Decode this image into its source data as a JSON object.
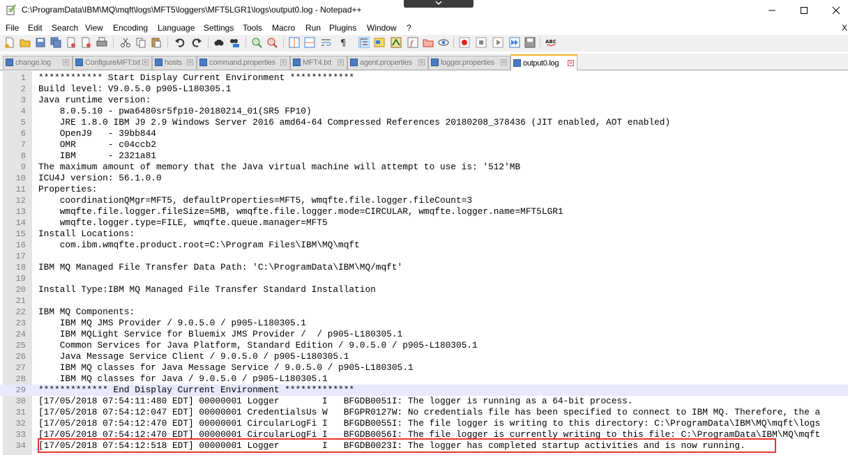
{
  "window": {
    "title": "C:\\ProgramData\\IBM\\MQ\\mqft\\logs\\MFT5\\loggers\\MFT5LGR1\\logs\\output0.log - Notepad++",
    "menu_close": "X"
  },
  "menu": [
    "File",
    "Edit",
    "Search",
    "View",
    "Encoding",
    "Language",
    "Settings",
    "Tools",
    "Macro",
    "Run",
    "Plugins",
    "Window",
    "?"
  ],
  "tabs": [
    {
      "label": "change.log"
    },
    {
      "label": "ConfigureMFT.txt"
    },
    {
      "label": "hosts"
    },
    {
      "label": "command.properties"
    },
    {
      "label": "MFT4.txt"
    },
    {
      "label": "agent.properties"
    },
    {
      "label": "logger.properties"
    },
    {
      "label": "output0.log",
      "active": true
    }
  ],
  "editor": {
    "current_line": 29,
    "highlighted_line": 34,
    "lines": [
      "************ Start Display Current Environment ************",
      "Build level: V9.0.5.0 p905-L180305.1",
      "Java runtime version:",
      "    8.0.5.10 - pwa6480sr5fp10-20180214_01(SR5 FP10)",
      "    JRE 1.8.0 IBM J9 2.9 Windows Server 2016 amd64-64 Compressed References 20180208_378436 (JIT enabled, AOT enabled)",
      "    OpenJ9   - 39bb844",
      "    OMR      - c04ccb2",
      "    IBM      - 2321a81",
      "The maximum amount of memory that the Java virtual machine will attempt to use is: '512'MB",
      "ICU4J version: 56.1.0.0",
      "Properties:",
      "    coordinationQMgr=MFT5, defaultProperties=MFT5, wmqfte.file.logger.fileCount=3",
      "    wmqfte.file.logger.fileSize=5MB, wmqfte.file.logger.mode=CIRCULAR, wmqfte.logger.name=MFT5LGR1",
      "    wmqfte.logger.type=FILE, wmqfte.queue.manager=MFT5",
      "Install Locations:",
      "    com.ibm.wmqfte.product.root=C:\\Program Files\\IBM\\MQ\\mqft",
      "",
      "IBM MQ Managed File Transfer Data Path: 'C:\\ProgramData\\IBM\\MQ/mqft'",
      "",
      "Install Type:IBM MQ Managed File Transfer Standard Installation",
      "",
      "IBM MQ Components:",
      "    IBM MQ JMS Provider / 9.0.5.0 / p905-L180305.1",
      "    IBM MQLight Service for Bluemix JMS Provider /  / p905-L180305.1",
      "    Common Services for Java Platform, Standard Edition / 9.0.5.0 / p905-L180305.1",
      "    Java Message Service Client / 9.0.5.0 / p905-L180305.1",
      "    IBM MQ classes for Java Message Service / 9.0.5.0 / p905-L180305.1",
      "    IBM MQ classes for Java / 9.0.5.0 / p905-L180305.1",
      "************* End Display Current Environment *************",
      "[17/05/2018 07:54:11:480 EDT] 00000001 Logger        I   BFGDB0051I: The logger is running as a 64-bit process.",
      "[17/05/2018 07:54:12:047 EDT] 00000001 CredentialsUs W   BFGPR0127W: No credentials file has been specified to connect to IBM MQ. Therefore, the a",
      "[17/05/2018 07:54:12:470 EDT] 00000001 CircularLogFi I   BFGDB0055I: The file logger is writing to this directory: C:\\ProgramData\\IBM\\MQ\\mqft\\logs",
      "[17/05/2018 07:54:12:470 EDT] 00000001 CircularLogFi I   BFGDB0056I: The file logger is currently writing to this file: C:\\ProgramData\\IBM\\MQ\\mqft",
      "[17/05/2018 07:54:12:518 EDT] 00000001 Logger        I   BFGDB0023I: The logger has completed startup activities and is now running."
    ]
  }
}
